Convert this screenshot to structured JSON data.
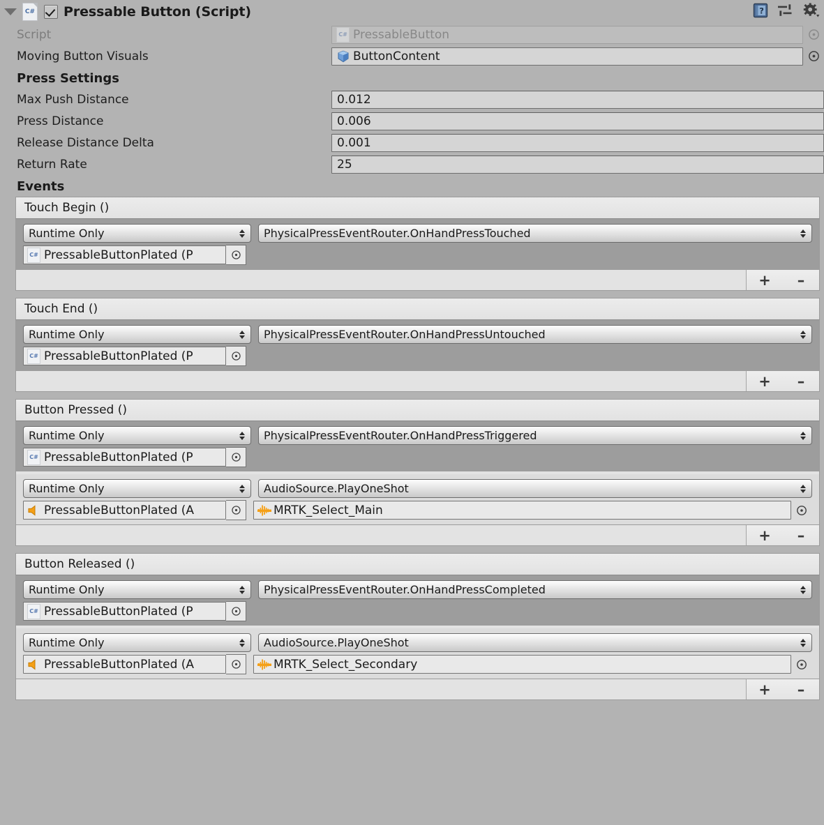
{
  "header": {
    "title": "Pressable Button (Script)",
    "enabled": true,
    "script_icon": "csharp-script-icon",
    "help_icon": "help-book-icon",
    "preset_icon": "preset-selector-icon",
    "settings_icon": "gear-icon"
  },
  "properties": [
    {
      "label": "Script",
      "value": "PressableButton",
      "icon": "csharp-script-icon",
      "disabled": true
    },
    {
      "label": "Moving Button Visuals",
      "value": "ButtonContent",
      "icon": "unity-gameobject-cube-icon",
      "disabled": false
    }
  ],
  "press_settings": {
    "title": "Press Settings",
    "fields": [
      {
        "label": "Max Push Distance",
        "value": "0.012"
      },
      {
        "label": "Press Distance",
        "value": "0.006"
      },
      {
        "label": "Release Distance Delta",
        "value": "0.001"
      },
      {
        "label": "Return Rate",
        "value": "25"
      }
    ]
  },
  "events_title": "Events",
  "events": [
    {
      "name": "Touch Begin ()",
      "entries": [
        {
          "mode": "Runtime Only",
          "method": "PhysicalPressEventRouter.OnHandPressTouched",
          "target": "PressableButtonPlated (P",
          "target_icon": "csharp-script-icon",
          "shade": "dark",
          "argument": null
        }
      ],
      "add_label": "+",
      "remove_label": "–"
    },
    {
      "name": "Touch End ()",
      "entries": [
        {
          "mode": "Runtime Only",
          "method": "PhysicalPressEventRouter.OnHandPressUntouched",
          "target": "PressableButtonPlated (P",
          "target_icon": "csharp-script-icon",
          "shade": "dark",
          "argument": null
        }
      ],
      "add_label": "+",
      "remove_label": "–"
    },
    {
      "name": "Button Pressed ()",
      "entries": [
        {
          "mode": "Runtime Only",
          "method": "PhysicalPressEventRouter.OnHandPressTriggered",
          "target": "PressableButtonPlated (P",
          "target_icon": "csharp-script-icon",
          "shade": "dark",
          "argument": null
        },
        {
          "mode": "Runtime Only",
          "method": "AudioSource.PlayOneShot",
          "target": "PressableButtonPlated (A",
          "target_icon": "audio-source-speaker-icon",
          "shade": "light",
          "argument": {
            "value": "MRTK_Select_Main",
            "icon": "audio-clip-waveform-icon"
          }
        }
      ],
      "add_label": "+",
      "remove_label": "–"
    },
    {
      "name": "Button Released ()",
      "entries": [
        {
          "mode": "Runtime Only",
          "method": "PhysicalPressEventRouter.OnHandPressCompleted",
          "target": "PressableButtonPlated (P",
          "target_icon": "csharp-script-icon",
          "shade": "dark",
          "argument": null
        },
        {
          "mode": "Runtime Only",
          "method": "AudioSource.PlayOneShot",
          "target": "PressableButtonPlated (A",
          "target_icon": "audio-source-speaker-icon",
          "shade": "light",
          "argument": {
            "value": "MRTK_Select_Secondary",
            "icon": "audio-clip-waveform-icon"
          }
        }
      ],
      "add_label": "+",
      "remove_label": "–"
    }
  ],
  "colors": {
    "background": "#b3b3b3",
    "field": "#d5d5d5",
    "row_dark": "#9d9d9d",
    "row_light": "#dcdcdc",
    "accent_orange": "#f5a017",
    "accent_blue": "#4a6fa5"
  }
}
